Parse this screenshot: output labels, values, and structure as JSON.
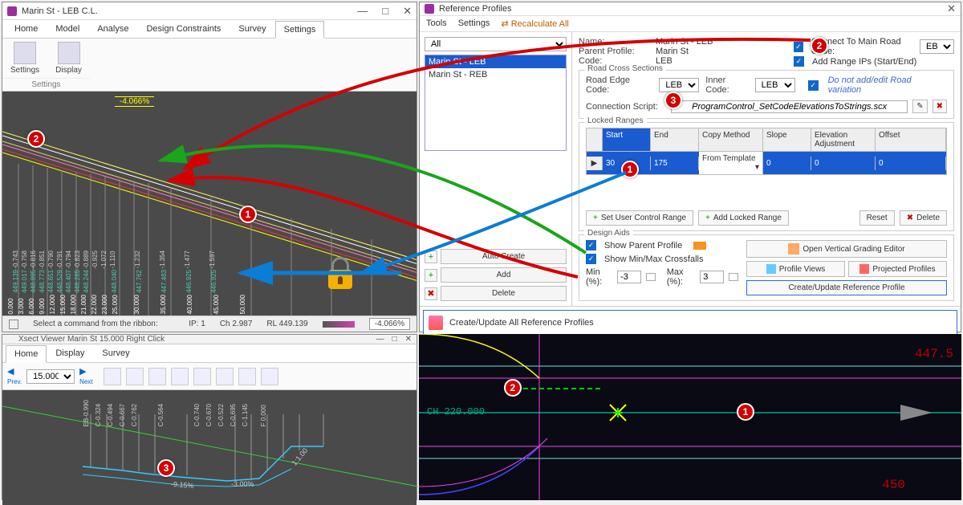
{
  "win_profile": {
    "title": "Marin St - LEB C.L.",
    "tabs": [
      "Home",
      "Model",
      "Analyse",
      "Design Constraints",
      "Survey",
      "Settings"
    ],
    "active_tab": 5,
    "ribbon": {
      "items": [
        "Settings",
        "Display"
      ],
      "group": "Settings"
    },
    "grade_label": "-4.066%",
    "chainages": [
      "0.000",
      "3.000",
      "6.000",
      "9.000",
      "12.000",
      "15.000",
      "18.000",
      "21.000",
      "22.000",
      "23.000",
      "25.000",
      "30.000",
      "35.000",
      "40.000",
      "45.000",
      "50.000"
    ],
    "top_levels": [
      "-0.743",
      "-0.758",
      "-0.816",
      "-0.851",
      "-0.790",
      "-0.791",
      "-0.794",
      "-0.823",
      "-0.889",
      "-0.925",
      "-1.072",
      "-1.110",
      "",
      "-1.232",
      "",
      "-1.354",
      "",
      "-1.477",
      "",
      "-1.597"
    ],
    "bottom_levels": [
      "449.139",
      "449.017",
      "448.895",
      "448.773",
      "448.651",
      "448.529",
      "448.407",
      "448.285",
      "448.244",
      "",
      "",
      "448.040",
      "",
      "447.762",
      "",
      "447.483",
      "",
      "446.925",
      "",
      "446.925"
    ],
    "status": {
      "prompt": "Select a command from the ribbon:",
      "ip": "IP: 1",
      "ch": "Ch 2.987",
      "rl": "RL 449.139",
      "grade": "-4.066%"
    }
  },
  "win_ref": {
    "title": "Reference Profiles",
    "menu": [
      "Tools",
      "Settings",
      "Recalculate All"
    ],
    "filter": "All",
    "list": [
      "Marin St - LEB",
      "Marin St - REB"
    ],
    "selected": 0,
    "auto_create": "Auto Create",
    "add": "Add",
    "delete": "Delete",
    "update_all": "Create/Update All Reference Profiles",
    "props": {
      "name_label": "Name:",
      "name": "Marin St - LEB",
      "parent_label": "Parent Profile:",
      "parent": "Marin St",
      "code_label": "Code:",
      "code": "LEB"
    },
    "connect": {
      "label": "Connect To Main Road Code:",
      "value": "EB"
    },
    "add_ips": "Add Range IPs (Start/End)",
    "cross": {
      "legend": "Road Cross Sections",
      "edge_label": "Road Edge Code:",
      "edge": "LEB",
      "inner_label": "Inner Code:",
      "inner": "LEB",
      "novari": "Do not add/edit Road variation",
      "script_label": "Connection Script:",
      "script": "ProgramControl_SetCodeElevationsToStrings.scx"
    },
    "locked": {
      "legend": "Locked Ranges",
      "headers": [
        "Start",
        "End",
        "Copy Method",
        "Slope",
        "Elevation Adjustment",
        "Offset"
      ],
      "row": {
        "start": "30",
        "end": "175",
        "method": "From Template",
        "slope": "0",
        "elev": "0",
        "offset": "0"
      },
      "set_user": "Set User Control Range",
      "add_locked": "Add Locked Range",
      "reset": "Reset",
      "delete": "Delete"
    },
    "aids": {
      "legend": "Design Aids",
      "show_parent": "Show Parent Profile",
      "show_cross": "Show Min/Max Crossfalls",
      "min_label": "Min (%):",
      "min": "-3",
      "max_label": "Max (%):",
      "max": "3",
      "open_vge": "Open Vertical Grading Editor",
      "profile_views": "Profile Views",
      "projected": "Projected Profiles",
      "create_update": "Create/Update Reference Profile"
    }
  },
  "win_xsect": {
    "title": "Xsect Viewer Marin St  15.000  Right Click",
    "tabs": [
      "Home",
      "Display",
      "Survey"
    ],
    "prev": "Prev.",
    "next": "Next",
    "ch_value": "15.000",
    "offsets": [
      "EB-0.990",
      "C-0.324",
      "C-0.494",
      "C-0.667",
      "C-0.762",
      "C-0.564",
      "C-0.740",
      "C-0.670",
      "C-0.522",
      "C-0.695",
      "C-1.145",
      "F 0.000"
    ],
    "grade_a": "-9.15%",
    "grade_b": "-3.00%",
    "slope": "1:1.00"
  },
  "cad": {
    "ch_label": "CH 220.000",
    "rl_label_a": "447.5",
    "rl_label_b": "450"
  },
  "callouts": {
    "profile_1": "1",
    "profile_2": "2",
    "ref_2": "2",
    "ref_3": "3",
    "table_1": "1",
    "xsect_3": "3",
    "cad_1": "1",
    "cad_2": "2"
  }
}
